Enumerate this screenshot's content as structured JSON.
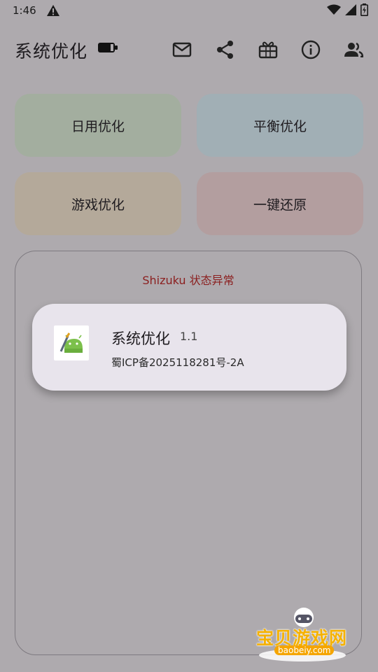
{
  "status_bar": {
    "time": "1:46"
  },
  "app_bar": {
    "title": "系统优化",
    "icons": [
      "battery-icon",
      "mail-icon",
      "share-icon",
      "gift-icon",
      "info-icon",
      "people-icon"
    ]
  },
  "buttons": {
    "daily": "日用优化",
    "balanced": "平衡优化",
    "game": "游戏优化",
    "restore": "一键还原"
  },
  "colors": {
    "daily": "#a3ae9f",
    "balanced": "#a1afb5",
    "game": "#b4a99a",
    "restore": "#b39e9f",
    "status_error": "#8b1f1f"
  },
  "panel": {
    "status": "Shizuku 状态异常",
    "card": {
      "name": "系统优化",
      "version": "1.1",
      "icp": "蜀ICP备2025118281号-2A"
    }
  },
  "watermark": {
    "text": "宝贝游戏网",
    "domain": "baobeiy.com"
  }
}
